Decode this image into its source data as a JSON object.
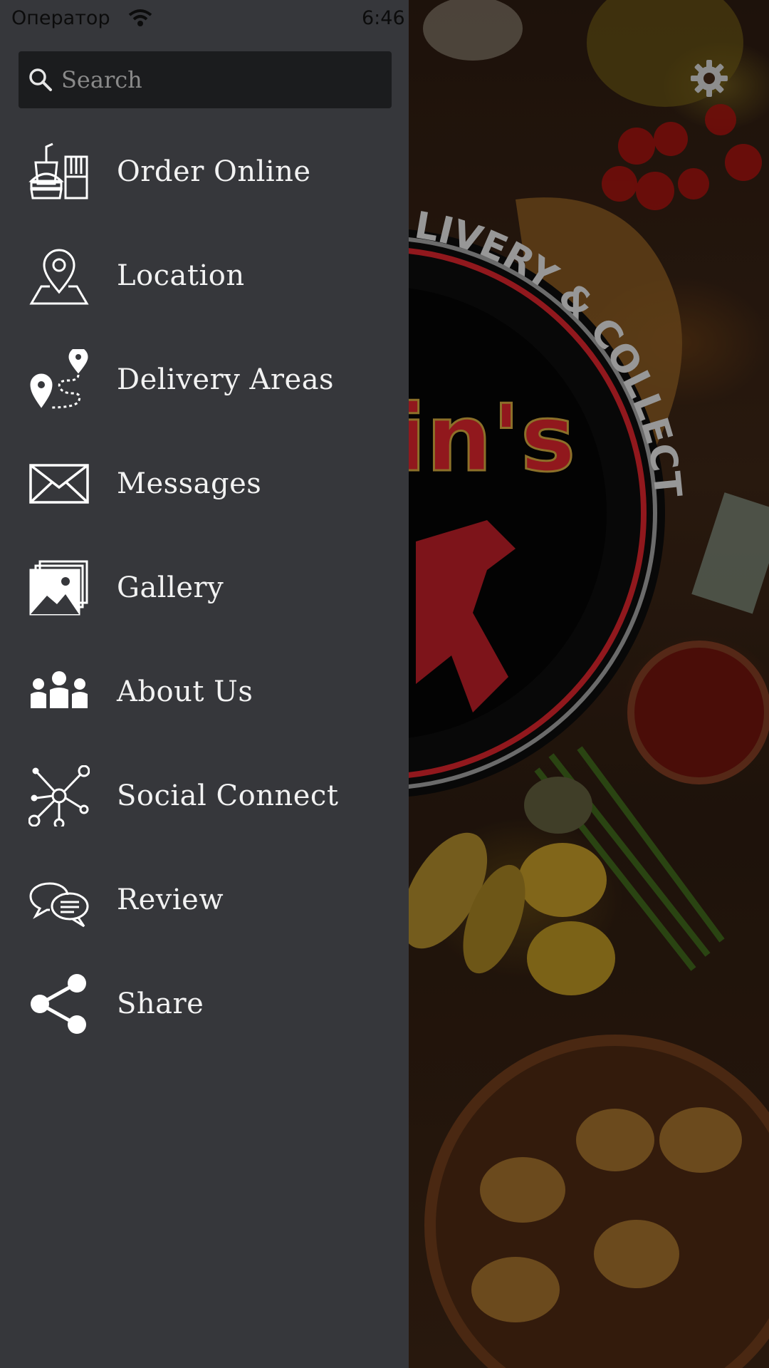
{
  "status_bar": {
    "carrier": "Оператор",
    "time": "6:46",
    "wifi_icon": "wifi-icon"
  },
  "search": {
    "placeholder": "Search",
    "value": "",
    "icon": "search-icon"
  },
  "menu": {
    "items": [
      {
        "label": "Order Online",
        "icon": "fast-food-icon"
      },
      {
        "label": "Location",
        "icon": "map-pin-icon"
      },
      {
        "label": "Delivery Areas",
        "icon": "route-pins-icon"
      },
      {
        "label": "Messages",
        "icon": "envelope-icon"
      },
      {
        "label": "Gallery",
        "icon": "photos-icon"
      },
      {
        "label": "About Us",
        "icon": "team-icon"
      },
      {
        "label": "Social Connect",
        "icon": "network-icon"
      },
      {
        "label": "Review",
        "icon": "chat-bubbles-icon"
      },
      {
        "label": "Share",
        "icon": "share-icon"
      }
    ]
  },
  "background": {
    "logo_text": "LIVERY & COLLECTION",
    "logo_partial_name": "in's",
    "settings_icon": "gear-icon"
  },
  "colors": {
    "drawer_bg": "#36373b",
    "search_bg": "#1b1c1e",
    "menu_text": "#f2f2f2",
    "logo_red": "#d0232a"
  }
}
